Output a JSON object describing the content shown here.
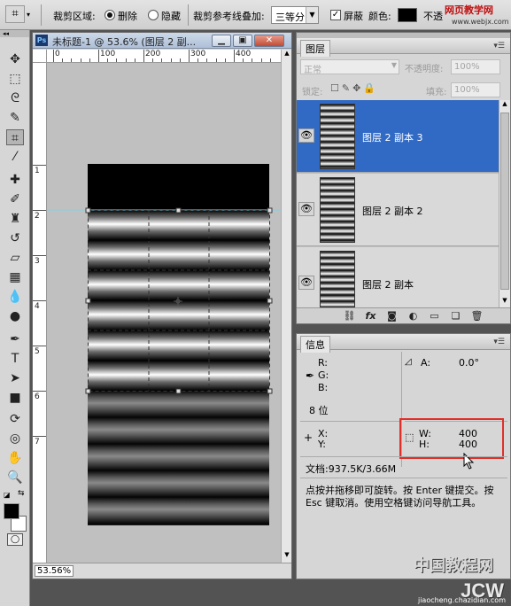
{
  "options_bar": {
    "crop_area_label": "裁剪区域:",
    "delete_label": "删除",
    "hide_label": "隐藏",
    "overlay_label": "裁剪参考线叠加:",
    "overlay_value": "三等分",
    "shield_label": "屏蔽",
    "color_label": "颜色:",
    "opacity_label_cut": "不透",
    "watermark_top": "网页教学网",
    "watermark_url": "www.webjx.com"
  },
  "document": {
    "title": "未标题-1 @ 53.6% (图层 2 副...",
    "zoom": "53.56%",
    "ruler_h": [
      "0",
      "100",
      "200",
      "300",
      "400"
    ],
    "ruler_v": [
      "1",
      "2",
      "3",
      "4",
      "5",
      "6",
      "7"
    ]
  },
  "layers_panel": {
    "tab": "图层",
    "blend_mode": "正常",
    "opacity_label": "不透明度:",
    "opacity_value": "100%",
    "lock_label": "锁定:",
    "fill_label": "填充:",
    "fill_value": "100%",
    "layers": [
      {
        "name": "图层 2 副本 3",
        "active": true
      },
      {
        "name": "图层 2 副本 2",
        "active": false
      },
      {
        "name": "图层 2 副本",
        "active": false
      }
    ]
  },
  "info_panel": {
    "tab": "信息",
    "r_label": "R:",
    "g_label": "G:",
    "b_label": "B:",
    "angle_label": "A:",
    "angle_value": "0.0°",
    "bit_depth": "8 位",
    "x_label": "X:",
    "y_label": "Y:",
    "w_label": "W:",
    "w_value": "400",
    "h_label": "H:",
    "h_value": "400",
    "doc_size": "文档:937.5K/3.66M",
    "hint": "点按并拖移即可旋转。按 Enter 键提交。按 Esc 键取消。使用空格键访问导航工具。"
  },
  "watermark": {
    "line1": "中国教程网",
    "line2": "JCW",
    "line3": "jiaocheng.chazidian.com"
  },
  "colors": {
    "panel_bg": "#d6d6d6",
    "selected_layer": "#316ac5",
    "highlight_box": "#e0302a"
  }
}
